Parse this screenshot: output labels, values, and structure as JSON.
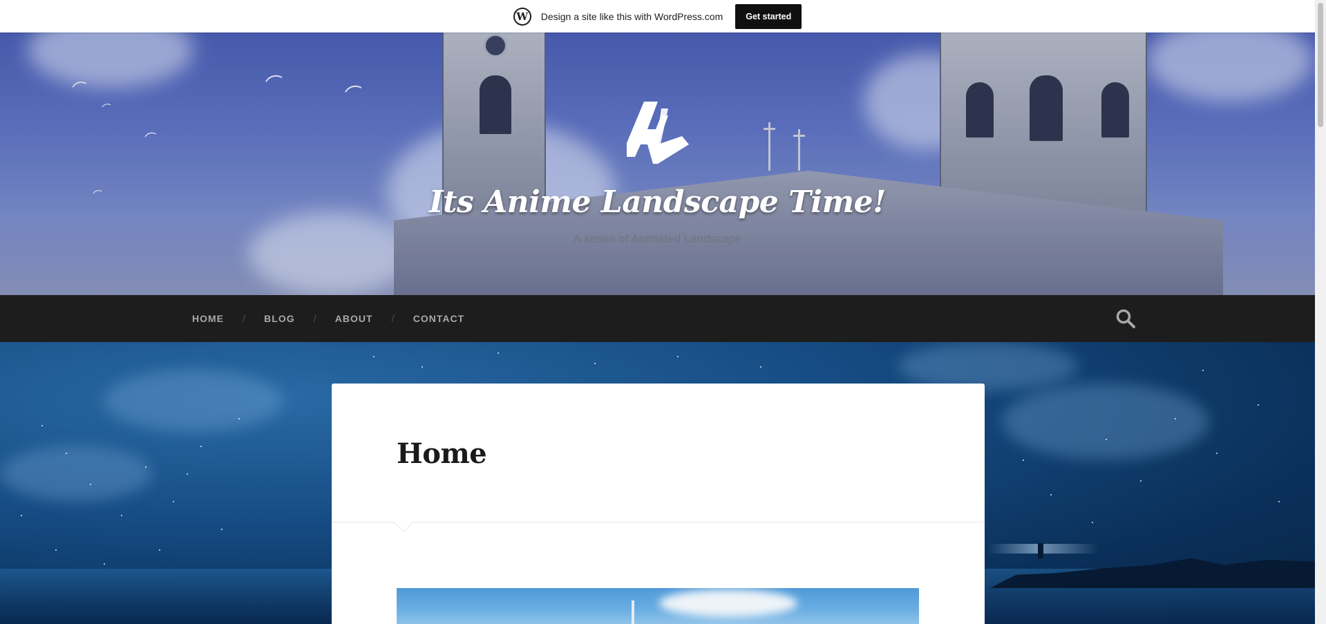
{
  "promo": {
    "logo": "wordpress-logo",
    "text": "Design a site like this with WordPress.com",
    "button_label": "Get started"
  },
  "site": {
    "logo_text": "AL",
    "title": "Its Anime Landscape Time!",
    "tagline": "A series of Animated Landscape"
  },
  "nav": {
    "items": [
      {
        "label": "HOME"
      },
      {
        "label": "BLOG"
      },
      {
        "label": "ABOUT"
      },
      {
        "label": "CONTACT"
      }
    ],
    "separator": "/",
    "search_icon": "search-icon"
  },
  "page": {
    "title": "Home"
  },
  "colors": {
    "nav_background": "#1d1d1d",
    "nav_text": "#a9a9a9",
    "promo_button": "#101010",
    "card_background": "#ffffff"
  }
}
